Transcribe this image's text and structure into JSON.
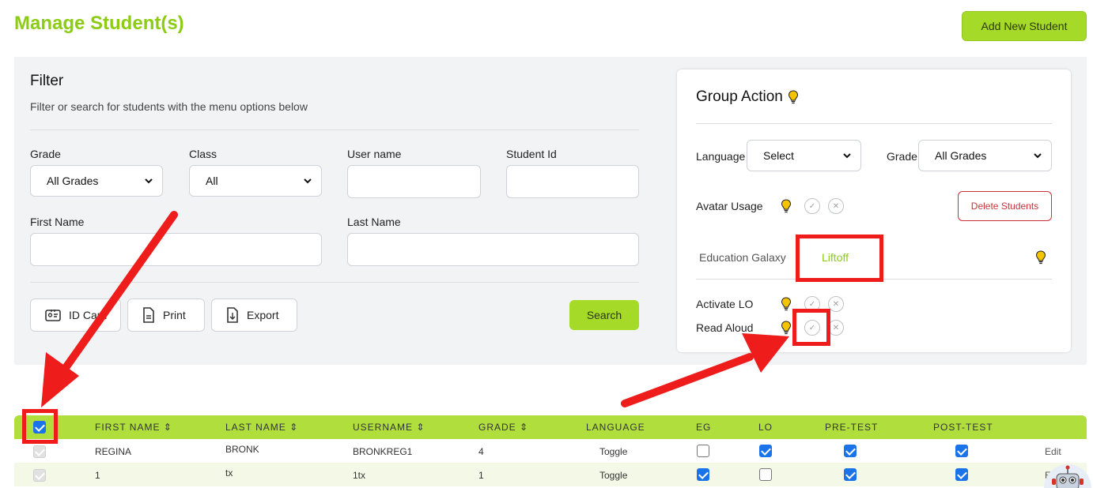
{
  "header": {
    "title": "Manage Student(s)",
    "add_button": "Add New Student"
  },
  "filter": {
    "title": "Filter",
    "subtitle": "Filter or search for students with the menu options below",
    "grade_label": "Grade",
    "grade_value": "All Grades",
    "class_label": "Class",
    "class_value": "All",
    "username_label": "User name",
    "studentid_label": "Student Id",
    "firstname_label": "First Name",
    "lastname_label": "Last Name",
    "idcard_button": "ID Card",
    "print_button": "Print",
    "export_button": "Export",
    "search_button": "Search"
  },
  "group_action": {
    "title": "Group Action",
    "language_label": "Language",
    "language_value": "Select",
    "grade_label": "Grade",
    "grade_value": "All Grades",
    "avatar_label": "Avatar Usage",
    "delete_button": "Delete Students",
    "tabs": [
      "Education Galaxy",
      "Liftoff"
    ],
    "activate_label": "Activate LO",
    "readaloud_label": "Read Aloud"
  },
  "table": {
    "headers": [
      "FIRST NAME",
      "LAST NAME",
      "USERNAME",
      "GRADE",
      "LANGUAGE",
      "EG",
      "LO",
      "PRE-TEST",
      "POST-TEST"
    ],
    "sort_glyph": "⇕",
    "rows": [
      {
        "first": "REGINA",
        "last": "BRONK",
        "username": "BRONKREG1",
        "grade": "4",
        "language": "Toggle",
        "eg": false,
        "lo": true,
        "pre": true,
        "post": true,
        "action": "Edit"
      },
      {
        "first": "1",
        "last": "tx",
        "username": "1tx",
        "grade": "1",
        "language": "Toggle",
        "eg": true,
        "lo": false,
        "pre": true,
        "post": true,
        "action": "Edit"
      }
    ]
  },
  "colors": {
    "brand": "#8ccc14",
    "button": "#a6da29",
    "table_header": "#b0de3c",
    "danger": "#c9323a",
    "annotation": "#ef1c1c"
  }
}
